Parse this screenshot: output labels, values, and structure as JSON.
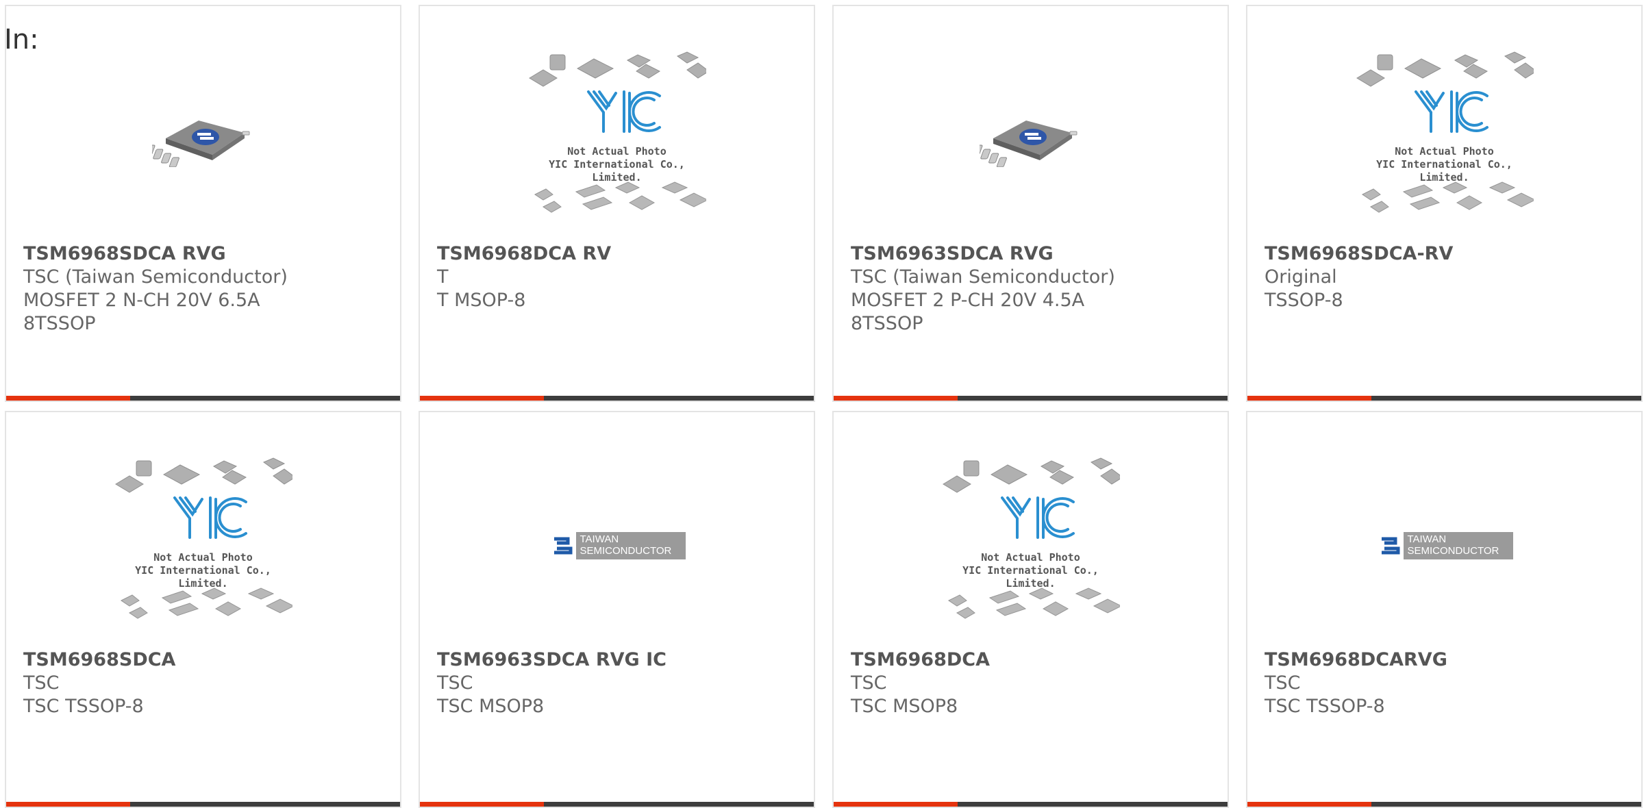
{
  "header": {
    "label": "In:"
  },
  "colors": {
    "accent": "#e5330e",
    "bar": "#3d3d3d",
    "text": "#666666",
    "border": "#e4e4e4"
  },
  "products": [
    {
      "name": "TSM6968SDCA RVG",
      "manufacturer": "TSC (Taiwan Semiconductor)",
      "description": "MOSFET 2 N-CH 20V 6.5A 8TSSOP",
      "image": "chip-icon"
    },
    {
      "name": "TSM6968DCA RV",
      "manufacturer": "T",
      "description": "T MSOP-8",
      "image": "not-actual-photo-placeholder",
      "placeholder_line1": "Not Actual Photo",
      "placeholder_line2": "YIC International Co., Limited."
    },
    {
      "name": "TSM6963SDCA RVG",
      "manufacturer": "TSC (Taiwan Semiconductor)",
      "description": "MOSFET 2 P-CH 20V 4.5A 8TSSOP",
      "image": "chip-icon"
    },
    {
      "name": "TSM6968SDCA-RV",
      "manufacturer": "Original",
      "description": "TSSOP-8",
      "image": "not-actual-photo-placeholder",
      "placeholder_line1": "Not Actual Photo",
      "placeholder_line2": "YIC International Co., Limited."
    },
    {
      "name": "TSM6968SDCA",
      "manufacturer": "TSC",
      "description": "TSC TSSOP-8",
      "image": "not-actual-photo-placeholder",
      "placeholder_line1": "Not Actual Photo",
      "placeholder_line2": "YIC International Co., Limited."
    },
    {
      "name": "TSM6963SDCA RVG IC",
      "manufacturer": "TSC",
      "description": "TSC MSOP8",
      "image": "taiwan-semiconductor-logo",
      "logo_line1": "TAIWAN",
      "logo_line2": "SEMICONDUCTOR"
    },
    {
      "name": "TSM6968DCA",
      "manufacturer": "TSC",
      "description": "TSC MSOP8",
      "image": "not-actual-photo-placeholder",
      "placeholder_line1": "Not Actual Photo",
      "placeholder_line2": "YIC International Co., Limited."
    },
    {
      "name": "TSM6968DCARVG",
      "manufacturer": "TSC",
      "description": "TSC TSSOP-8",
      "image": "taiwan-semiconductor-logo",
      "logo_line1": "TAIWAN",
      "logo_line2": "SEMICONDUCTOR"
    }
  ]
}
